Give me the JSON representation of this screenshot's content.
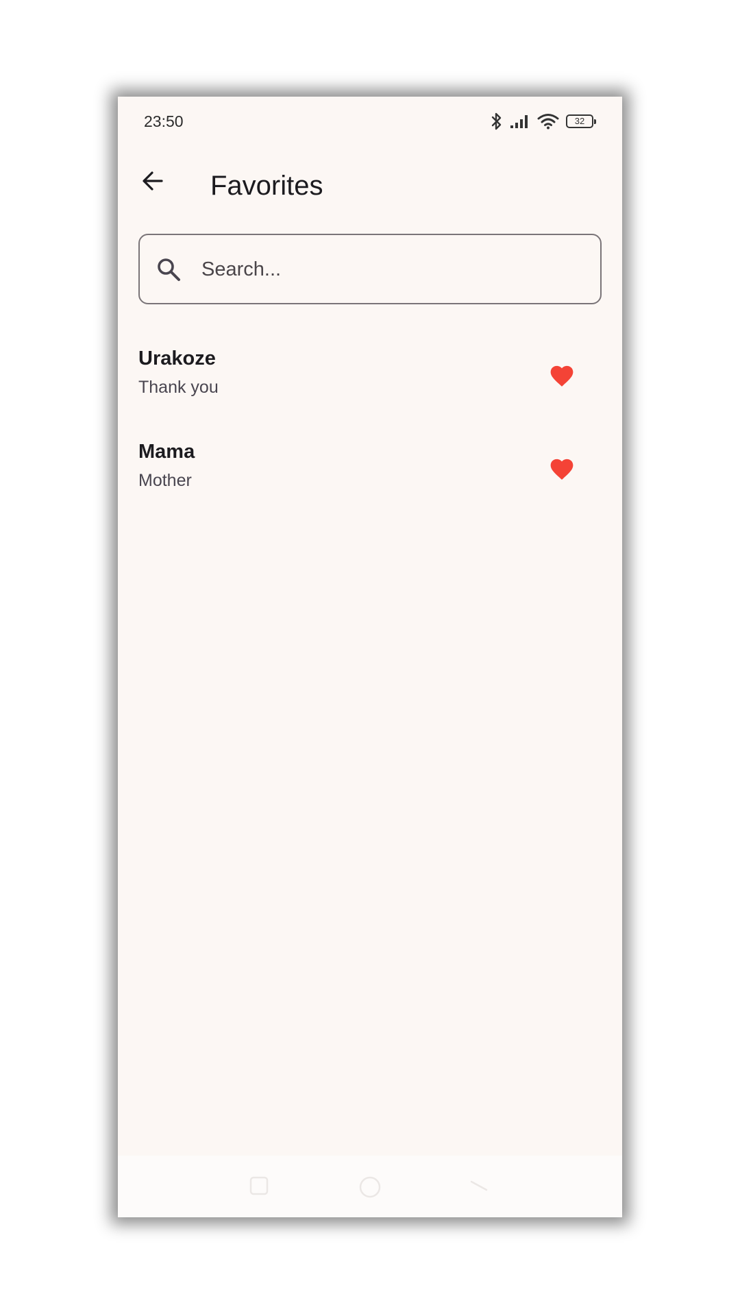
{
  "status_bar": {
    "time": "23:50",
    "battery_level": "32",
    "icons": [
      "bluetooth-icon",
      "cellular-signal-icon",
      "wifi-icon",
      "battery-icon"
    ]
  },
  "app_bar": {
    "title": "Favorites",
    "back_icon": "arrow-back-icon"
  },
  "search": {
    "placeholder": "Search...",
    "value": "",
    "icon": "search-icon"
  },
  "favorites": [
    {
      "word": "Urakoze",
      "translation": "Thank you",
      "favorited": true
    },
    {
      "word": "Mama",
      "translation": "Mother",
      "favorited": true
    }
  ],
  "nav_bar": {
    "buttons": [
      "recents-button",
      "home-button",
      "back-button"
    ]
  },
  "colors": {
    "background": "#fcf7f4",
    "heart": "#f44336",
    "text_primary": "#1c1b1f",
    "text_secondary": "#49454f",
    "outline": "#7a7478"
  }
}
